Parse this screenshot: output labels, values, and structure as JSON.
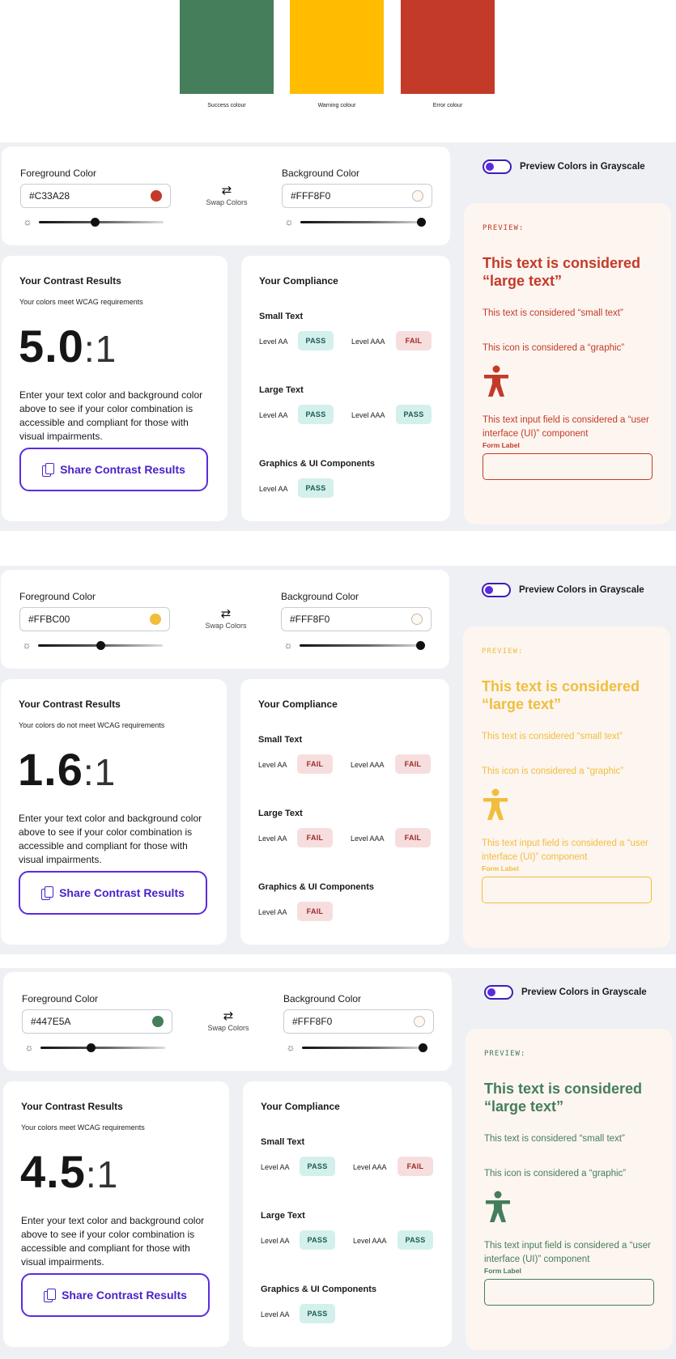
{
  "swatches": [
    {
      "label": "Success colour",
      "color": "#447E5A"
    },
    {
      "label": "Warning colour",
      "color": "#FFBC00"
    },
    {
      "label": "Error colour",
      "color": "#C33A28"
    }
  ],
  "labels": {
    "foreground": "Foreground Color",
    "background": "Background Color",
    "swap": "Swap Colors",
    "grayscale": "Preview Colors in Grayscale",
    "results_title": "Your Contrast Results",
    "description": "Enter your text color and background color above to see if your color combination is accessible and compliant for those with visual impairments.",
    "share": "Share Contrast Results",
    "compliance_title": "Your Compliance",
    "small_text": "Small Text",
    "large_text": "Large Text",
    "graphics": "Graphics & UI Components",
    "level_aa": "Level AA",
    "level_aaa": "Level AAA",
    "preview_tag": "PREVIEW:",
    "preview_large": "This text is considered “large text”",
    "preview_small": "This text is considered “small text”",
    "preview_icon": "This icon is considered a “graphic”",
    "preview_input": "This text input field is considered a “user interface (UI)” component",
    "form_label": "Form Label"
  },
  "sections": [
    {
      "foreground_value": "#C33A28",
      "fg_color": "#C33A28",
      "background_value": "#FFF8F0",
      "bg_color": "#FFF8F0",
      "fg_brightness": 0.45,
      "bg_brightness": 0.97,
      "status": "Your colors meet WCAG requirements",
      "ratio": "5.0",
      "ratio_suffix": ":1",
      "small_aa": "PASS",
      "small_aaa": "FAIL",
      "large_aa": "PASS",
      "large_aaa": "PASS",
      "graphics_aa": "PASS"
    },
    {
      "foreground_value": "#FFBC00",
      "fg_color": "#F0BE3C",
      "background_value": "#FFF8F0",
      "bg_color": "#FFF8F0",
      "fg_brightness": 0.5,
      "bg_brightness": 0.97,
      "status": "Your colors do not meet WCAG requirements",
      "ratio": "1.6",
      "ratio_suffix": ":1",
      "small_aa": "FAIL",
      "small_aaa": "FAIL",
      "large_aa": "FAIL",
      "large_aaa": "FAIL",
      "graphics_aa": "FAIL"
    },
    {
      "foreground_value": "#447E5A",
      "fg_color": "#447E5A",
      "background_value": "#FFF8F0",
      "bg_color": "#FFF8F0",
      "fg_brightness": 0.4,
      "bg_brightness": 0.97,
      "status": "Your colors meet WCAG requirements",
      "ratio": "4.5",
      "ratio_suffix": ":1",
      "small_aa": "PASS",
      "small_aaa": "FAIL",
      "large_aa": "PASS",
      "large_aaa": "PASS",
      "graphics_aa": "PASS"
    }
  ]
}
